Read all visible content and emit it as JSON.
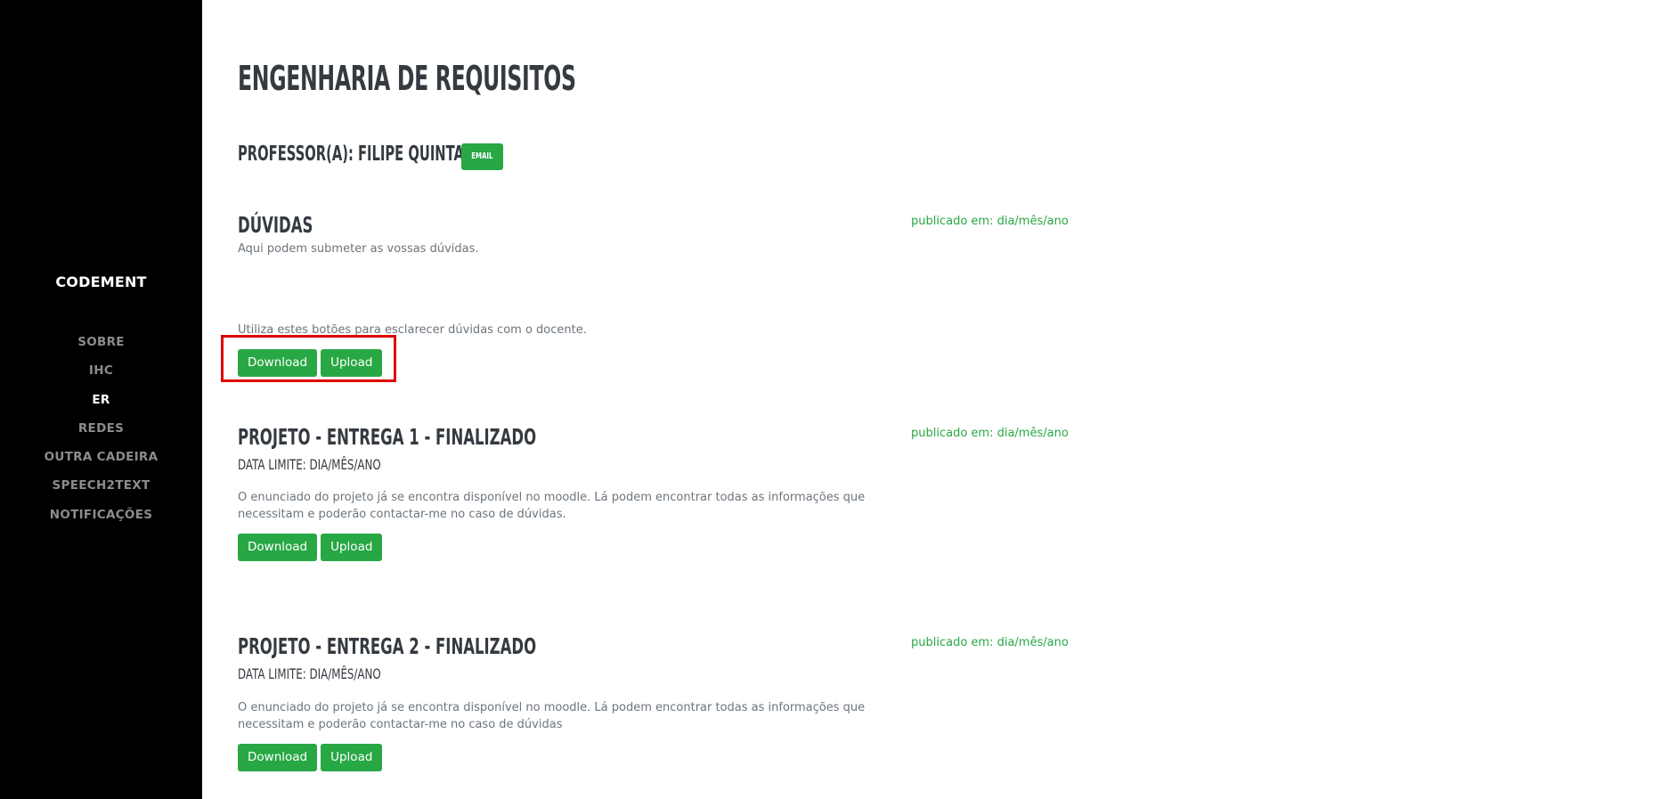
{
  "sidebar": {
    "brand": "CODEMENT",
    "items": [
      {
        "label": "SOBRE"
      },
      {
        "label": "IHC"
      },
      {
        "label": "ER"
      },
      {
        "label": "REDES"
      },
      {
        "label": "OUTRA CADEIRA"
      },
      {
        "label": "SPEECH2TEXT"
      },
      {
        "label": "NOTIFICAÇÕES"
      }
    ],
    "active_item": "ER"
  },
  "main": {
    "title": "ENGENHARIA DE REQUISITOS",
    "professor": "PROFESSOR(A): FILIPE QUINTAL",
    "email_label": "EMAIL",
    "sections": [
      {
        "title": "DÚVIDAS",
        "published": "publicado em: dia/mês/ano",
        "intro": "Aqui podem submeter as vossas dúvidas.",
        "description": "Utiliza estes botões para esclarecer dúvidas com o docente.",
        "download_label": "Download",
        "upload_label": "Upload"
      },
      {
        "title": "PROJETO - ENTREGA 1 - FINALIZADO",
        "published": "publicado em: dia/mês/ano",
        "deadline": "DATA LIMITE: DIA/MÊS/ANO",
        "description": "O enunciado do projeto já se encontra disponível no moodle. Lá podem encontrar todas as informações que necessitam e poderão contactar-me no caso de dúvidas.",
        "download_label": "Download",
        "upload_label": "Upload"
      },
      {
        "title": "PROJETO - ENTREGA 2 - FINALIZADO",
        "published": "publicado em: dia/mês/ano",
        "deadline": "DATA LIMITE: DIA/MÊS/ANO",
        "description": "O enunciado do projeto já se encontra disponível no moodle. Lá podem encontrar todas as informações que necessitam e poderão contactar-me no caso de dúvidas",
        "download_label": "Download",
        "upload_label": "Upload"
      }
    ]
  },
  "colors": {
    "sidebar_bg": "#000000",
    "accent_green": "#28a745",
    "heading": "#343a40",
    "highlight": "#e00000"
  }
}
